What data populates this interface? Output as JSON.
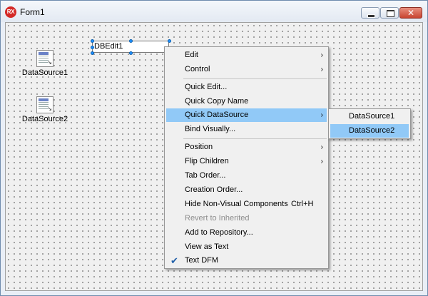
{
  "window": {
    "title": "Form1",
    "icon_text": "RX"
  },
  "components": {
    "datasource1": "DataSource1",
    "datasource2": "DataSource2",
    "dbedit": "DBEdit1"
  },
  "context_menu": {
    "items": [
      {
        "label": "Edit",
        "submenu": true
      },
      {
        "label": "Control",
        "submenu": true
      },
      {
        "label": "Quick Edit..."
      },
      {
        "label": "Quick Copy Name"
      },
      {
        "label": "Quick DataSource",
        "submenu": true,
        "highlighted": true
      },
      {
        "label": "Bind Visually..."
      },
      {
        "label": "Position",
        "submenu": true
      },
      {
        "label": "Flip Children",
        "submenu": true
      },
      {
        "label": "Tab Order..."
      },
      {
        "label": "Creation Order..."
      },
      {
        "label": "Hide Non-Visual Components",
        "shortcut": "Ctrl+H"
      },
      {
        "label": "Revert to Inherited",
        "disabled": true
      },
      {
        "label": "Add to Repository..."
      },
      {
        "label": "View as Text"
      },
      {
        "label": "Text DFM",
        "checked": true
      }
    ]
  },
  "submenu": {
    "items": [
      {
        "label": "DataSource1"
      },
      {
        "label": "DataSource2",
        "highlighted": true
      }
    ]
  },
  "colors": {
    "highlight": "#91c9f7",
    "title_bg": "#e3e9f2",
    "close_button": "#c84430"
  },
  "icons": {
    "submenu_arrow": "chevron-right-icon",
    "check": "check-icon"
  }
}
